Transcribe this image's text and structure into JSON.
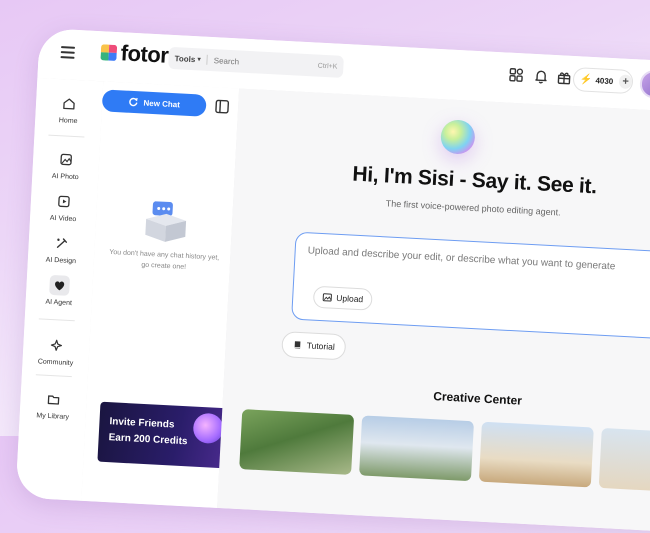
{
  "app": {
    "logo_text": "fotor",
    "brand_colors": [
      "#f9c34a",
      "#ef4d7a",
      "#36b37e",
      "#3d7bf7"
    ]
  },
  "header": {
    "search_scope": "Tools",
    "search_placeholder": "Search",
    "search_shortcut": "Ctrl+K",
    "credits": "4030",
    "icons": [
      "apps-icon",
      "bell-icon",
      "gift-icon"
    ]
  },
  "sidebar": {
    "items": [
      {
        "label": "Home",
        "icon": "home-icon"
      },
      {
        "label": "AI Photo",
        "icon": "ai-photo-icon"
      },
      {
        "label": "AI Video",
        "icon": "ai-video-icon"
      },
      {
        "label": "AI Design",
        "icon": "ai-design-icon"
      },
      {
        "label": "AI Agent",
        "icon": "ai-agent-icon",
        "active": true
      },
      {
        "label": "Community",
        "icon": "community-icon"
      },
      {
        "label": "My Library",
        "icon": "folder-icon"
      }
    ]
  },
  "chat": {
    "new_chat_label": "New Chat",
    "empty_line1": "You don't have any chat history yet,",
    "empty_line2": "go create one!",
    "promo_line1": "Invite Friends",
    "promo_line2": "Earn 200 Credits"
  },
  "main": {
    "headline": "Hi, I'm Sisi - Say it. See it.",
    "subheadline": "The first voice-powered photo editing agent.",
    "prompt_placeholder": "Upload and describe your edit, or describe what you want to generate",
    "upload_label": "Upload",
    "tutorial_label": "Tutorial",
    "section_title": "Creative Center",
    "accent_color": "#2f7bf5"
  }
}
